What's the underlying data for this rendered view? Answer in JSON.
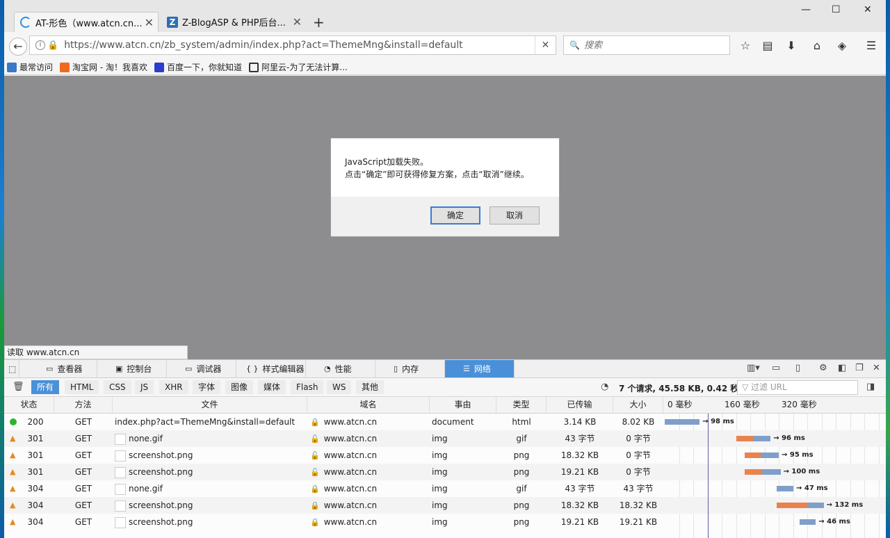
{
  "browser": {
    "tabs": [
      {
        "title": "AT-形色（www.atcn.cn...",
        "active": true
      },
      {
        "title": "Z-BlogASP & PHP后台...",
        "active": false
      }
    ],
    "new_tab": "+",
    "window_controls": {
      "minimize": "—",
      "maximize": "☐",
      "close": "✕"
    },
    "url": "https://www.atcn.cn/zb_system/admin/index.php?act=ThemeMng&install=default",
    "search_placeholder": "搜索",
    "bookmarks": [
      {
        "label": "最常访问",
        "color": "#3a78c8"
      },
      {
        "label": "淘宝网 - 淘！我喜欢",
        "color": "#f06a1c"
      },
      {
        "label": "百度一下，你就知道",
        "color": "#2b3fcc"
      },
      {
        "label": "阿里云-为了无法计算...",
        "color": "#333333"
      }
    ],
    "status_text": "读取 www.atcn.cn"
  },
  "dialog": {
    "line1": "JavaScript加载失败。",
    "line2": "点击“确定”即可获得修复方案，点击“取消”继续。",
    "ok_label": "确定",
    "cancel_label": "取消"
  },
  "devtools": {
    "tabs": [
      "查看器",
      "控制台",
      "调试器",
      "样式编辑器",
      "性能",
      "内存",
      "网络"
    ],
    "active_tab": "网络",
    "filters": [
      "所有",
      "HTML",
      "CSS",
      "JS",
      "XHR",
      "字体",
      "图像",
      "媒体",
      "Flash",
      "WS",
      "其他"
    ],
    "summary": "7 个请求, 45.58 KB, 0.42 秒",
    "url_filter_placeholder": "过滤 URL",
    "columns": [
      "状态",
      "方法",
      "文件",
      "域名",
      "事由",
      "类型",
      "已传输",
      "大小"
    ],
    "timeline_ticks": [
      "0 毫秒",
      "160 毫秒",
      "320 毫秒"
    ],
    "requests": [
      {
        "status": "200",
        "kind": "ok",
        "method": "GET",
        "file": "index.php?act=ThemeMng&install=default",
        "secure": true,
        "domain": "www.atcn.cn",
        "cause": "document",
        "type": "html",
        "transferred": "3.14 KB",
        "size": "8.02 KB",
        "start": 0,
        "wait": 0,
        "recv": 98,
        "duration": "→ 98 ms"
      },
      {
        "status": "301",
        "kind": "redirect",
        "method": "GET",
        "file": "none.gif",
        "secure": false,
        "domain": "www.atcn.cn",
        "cause": "img",
        "type": "gif",
        "transferred": "43 字节",
        "size": "0 字节",
        "start": 201,
        "wait": 46,
        "recv": 50,
        "duration": "→ 96 ms"
      },
      {
        "status": "301",
        "kind": "redirect",
        "method": "GET",
        "file": "screenshot.png",
        "secure": false,
        "domain": "www.atcn.cn",
        "cause": "img",
        "type": "png",
        "transferred": "18.32 KB",
        "size": "0 字节",
        "start": 225,
        "wait": 45,
        "recv": 50,
        "duration": "→ 95 ms"
      },
      {
        "status": "301",
        "kind": "redirect",
        "method": "GET",
        "file": "screenshot.png",
        "secure": false,
        "domain": "www.atcn.cn",
        "cause": "img",
        "type": "png",
        "transferred": "19.21 KB",
        "size": "0 字节",
        "start": 225,
        "wait": 48,
        "recv": 52,
        "duration": "→ 100 ms"
      },
      {
        "status": "304",
        "kind": "redirect",
        "method": "GET",
        "file": "none.gif",
        "secure": true,
        "domain": "www.atcn.cn",
        "cause": "img",
        "type": "gif",
        "transferred": "43 字节",
        "size": "43 字节",
        "start": 314,
        "wait": 0,
        "recv": 47,
        "duration": "→ 47 ms"
      },
      {
        "status": "304",
        "kind": "redirect",
        "method": "GET",
        "file": "screenshot.png",
        "secure": true,
        "domain": "www.atcn.cn",
        "cause": "img",
        "type": "png",
        "transferred": "18.32 KB",
        "size": "18.32 KB",
        "start": 314,
        "wait": 88,
        "recv": 44,
        "duration": "→ 132 ms"
      },
      {
        "status": "304",
        "kind": "redirect",
        "method": "GET",
        "file": "screenshot.png",
        "secure": true,
        "domain": "www.atcn.cn",
        "cause": "img",
        "type": "png",
        "transferred": "19.21 KB",
        "size": "19.21 KB",
        "start": 378,
        "wait": 0,
        "recv": 46,
        "duration": "→ 46 ms"
      }
    ],
    "colors": {
      "wait": "#e8834e",
      "receive": "#7f9fc9",
      "accent": "#4a90d9"
    }
  }
}
